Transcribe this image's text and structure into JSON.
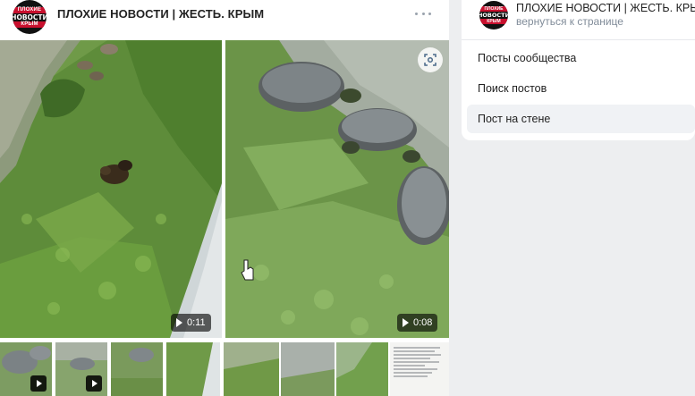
{
  "post": {
    "group_name": "ПЛОХИЕ НОВОСТИ | ЖЕСТЬ. КРЫМ",
    "avatar_text": {
      "top": "ПЛОХИЕ",
      "middle": "НОВОСТИ",
      "bottom": "КРЫМ"
    },
    "more_icon": "more-horizontal-icon",
    "videos": [
      {
        "duration": "0:11",
        "subject": "ducklings on grass"
      },
      {
        "duration": "0:08",
        "subject": "turtles on grass"
      }
    ],
    "scan_icon": "scan-icon"
  },
  "sidebar": {
    "group_title": "ПЛОХИЕ НОВОСТИ | ЖЕСТЬ. КРЫМ",
    "back_link": "вернуться к странице",
    "items": [
      {
        "label": "Посты сообщества"
      },
      {
        "label": "Поиск постов"
      },
      {
        "label": "Пост на стене",
        "active": true
      }
    ]
  },
  "colors": {
    "page_bg": "#edeef0",
    "card_bg": "#ffffff",
    "brand_red": "#c8102e",
    "muted_text": "#818c99",
    "active_item_bg": "#f0f2f5"
  }
}
